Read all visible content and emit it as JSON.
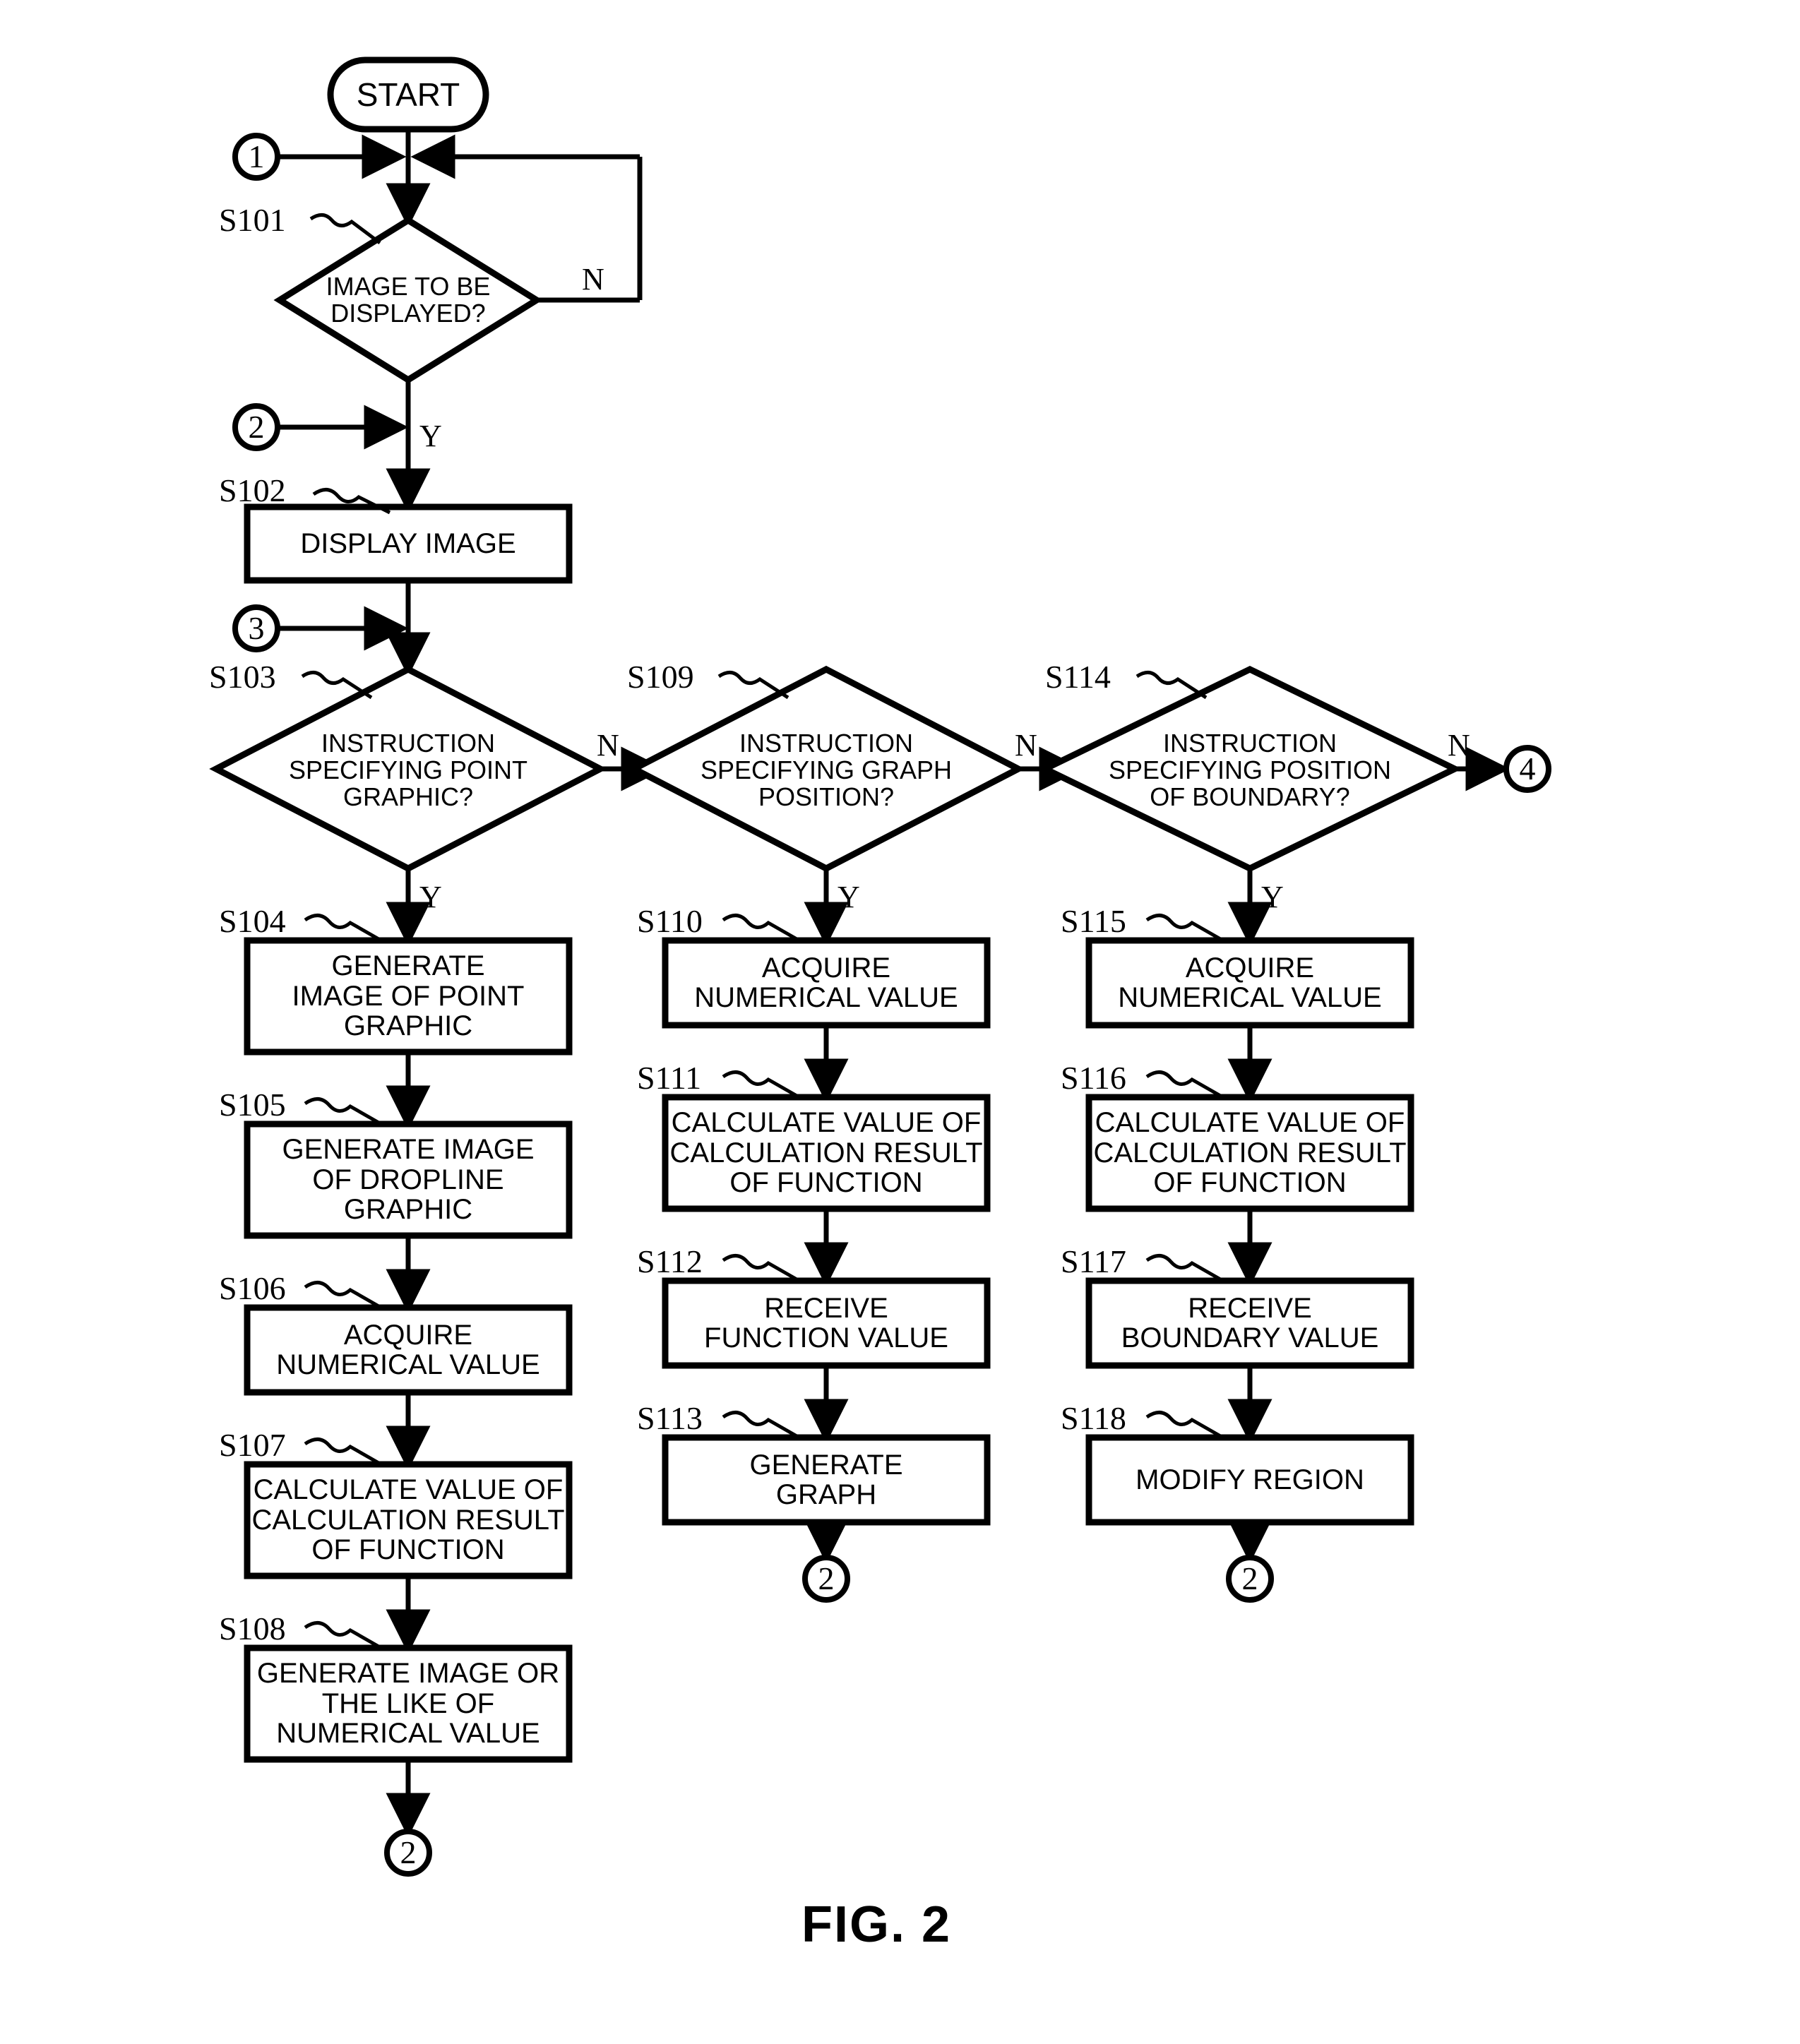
{
  "figure": {
    "caption": "FIG. 2"
  },
  "terminal": {
    "start_label": "START"
  },
  "connectors": {
    "c1": "1",
    "c2": "2",
    "c3": "3",
    "c4": "4"
  },
  "branch": {
    "yes": "Y",
    "no": "N"
  },
  "steps": [
    {
      "id": "S101",
      "type": "decision",
      "label": "IMAGE TO BE\nDISPLAYED?"
    },
    {
      "id": "S102",
      "type": "process",
      "label": "DISPLAY IMAGE"
    },
    {
      "id": "S103",
      "type": "decision",
      "label": "INSTRUCTION\nSPECIFYING POINT\nGRAPHIC?"
    },
    {
      "id": "S104",
      "type": "process",
      "label": "GENERATE\nIMAGE OF POINT\nGRAPHIC"
    },
    {
      "id": "S105",
      "type": "process",
      "label": "GENERATE IMAGE\nOF DROPLINE\nGRAPHIC"
    },
    {
      "id": "S106",
      "type": "process",
      "label": "ACQUIRE\nNUMERICAL VALUE"
    },
    {
      "id": "S107",
      "type": "process",
      "label": "CALCULATE VALUE OF\nCALCULATION RESULT\nOF FUNCTION"
    },
    {
      "id": "S108",
      "type": "process",
      "label": "GENERATE IMAGE OR\nTHE LIKE OF\nNUMERICAL VALUE"
    },
    {
      "id": "S109",
      "type": "decision",
      "label": "INSTRUCTION\nSPECIFYING GRAPH\nPOSITION?"
    },
    {
      "id": "S110",
      "type": "process",
      "label": "ACQUIRE\nNUMERICAL VALUE"
    },
    {
      "id": "S111",
      "type": "process",
      "label": "CALCULATE VALUE OF\nCALCULATION RESULT\nOF FUNCTION"
    },
    {
      "id": "S112",
      "type": "process",
      "label": "RECEIVE\nFUNCTION VALUE"
    },
    {
      "id": "S113",
      "type": "process",
      "label": "GENERATE\nGRAPH"
    },
    {
      "id": "S114",
      "type": "decision",
      "label": "INSTRUCTION\nSPECIFYING POSITION\nOF BOUNDARY?"
    },
    {
      "id": "S115",
      "type": "process",
      "label": "ACQUIRE\nNUMERICAL VALUE"
    },
    {
      "id": "S116",
      "type": "process",
      "label": "CALCULATE VALUE OF\nCALCULATION RESULT\nOF FUNCTION"
    },
    {
      "id": "S117",
      "type": "process",
      "label": "RECEIVE\nBOUNDARY VALUE"
    },
    {
      "id": "S118",
      "type": "process",
      "label": "MODIFY REGION"
    }
  ],
  "colors": {
    "stroke": "#000000",
    "background": "#ffffff"
  }
}
